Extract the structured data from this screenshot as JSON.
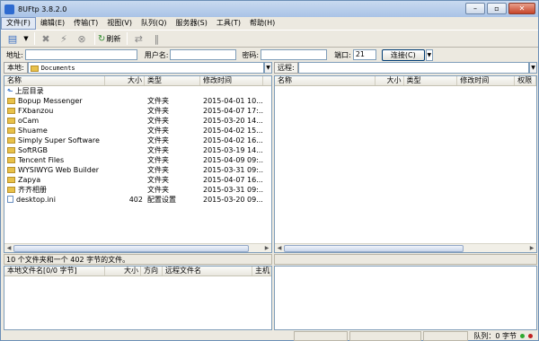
{
  "window": {
    "title": "8UFtp 3.8.2.0"
  },
  "menu": [
    {
      "label": "文件(F)"
    },
    {
      "label": "编辑(E)"
    },
    {
      "label": "传输(T)"
    },
    {
      "label": "视图(V)"
    },
    {
      "label": "队列(Q)"
    },
    {
      "label": "服务器(S)"
    },
    {
      "label": "工具(T)"
    },
    {
      "label": "帮助(H)"
    }
  ],
  "toolbar": {
    "refresh_label": "刷新"
  },
  "connection": {
    "address_label": "地址:",
    "username_label": "用户名:",
    "password_label": "密码:",
    "port_label": "端口:",
    "port_value": "21",
    "connect_label": "连接(C)"
  },
  "local": {
    "label": "本地:",
    "path": "Documents",
    "columns": [
      "名称",
      "大小",
      "类型",
      "修改时间"
    ],
    "files": [
      {
        "name": "上层目录",
        "size": "",
        "type": "",
        "date": "",
        "kind": "up"
      },
      {
        "name": "Bopup Messenger",
        "size": "",
        "type": "文件夹",
        "date": "2015-04-01 10...",
        "kind": "folder"
      },
      {
        "name": "FXbanzou",
        "size": "",
        "type": "文件夹",
        "date": "2015-04-07 17:...",
        "kind": "folder"
      },
      {
        "name": "oCam",
        "size": "",
        "type": "文件夹",
        "date": "2015-03-20 14...",
        "kind": "folder"
      },
      {
        "name": "Shuame",
        "size": "",
        "type": "文件夹",
        "date": "2015-04-02 15...",
        "kind": "folder"
      },
      {
        "name": "Simply Super Software",
        "size": "",
        "type": "文件夹",
        "date": "2015-04-02 16...",
        "kind": "folder"
      },
      {
        "name": "SoftRGB",
        "size": "",
        "type": "文件夹",
        "date": "2015-03-19 14...",
        "kind": "folder"
      },
      {
        "name": "Tencent Files",
        "size": "",
        "type": "文件夹",
        "date": "2015-04-09 09:...",
        "kind": "folder"
      },
      {
        "name": "WYSIWYG Web Builder",
        "size": "",
        "type": "文件夹",
        "date": "2015-03-31 09:...",
        "kind": "folder"
      },
      {
        "name": "Zapya",
        "size": "",
        "type": "文件夹",
        "date": "2015-04-07 16...",
        "kind": "folder"
      },
      {
        "name": "齐齐相册",
        "size": "",
        "type": "文件夹",
        "date": "2015-03-31 09:...",
        "kind": "folder"
      },
      {
        "name": "desktop.ini",
        "size": "402",
        "type": "配置设置",
        "date": "2015-03-20 09...",
        "kind": "ini"
      }
    ],
    "status": "10 个文件夹和一个 402 字节的文件。"
  },
  "remote": {
    "label": "远程:",
    "columns": [
      "名称",
      "大小",
      "类型",
      "修改时间",
      "权限"
    ]
  },
  "queue": {
    "columns": [
      "本地文件名[0/0 字节]",
      "大小",
      "方向",
      "远程文件名",
      "主机"
    ]
  },
  "statusbar": {
    "queue_text": "队列：0 字节"
  },
  "colors": {
    "accent": "#2e6bd0",
    "folder": "#e8c14a",
    "led_green": "#2fa82f",
    "led_red": "#c02020"
  }
}
